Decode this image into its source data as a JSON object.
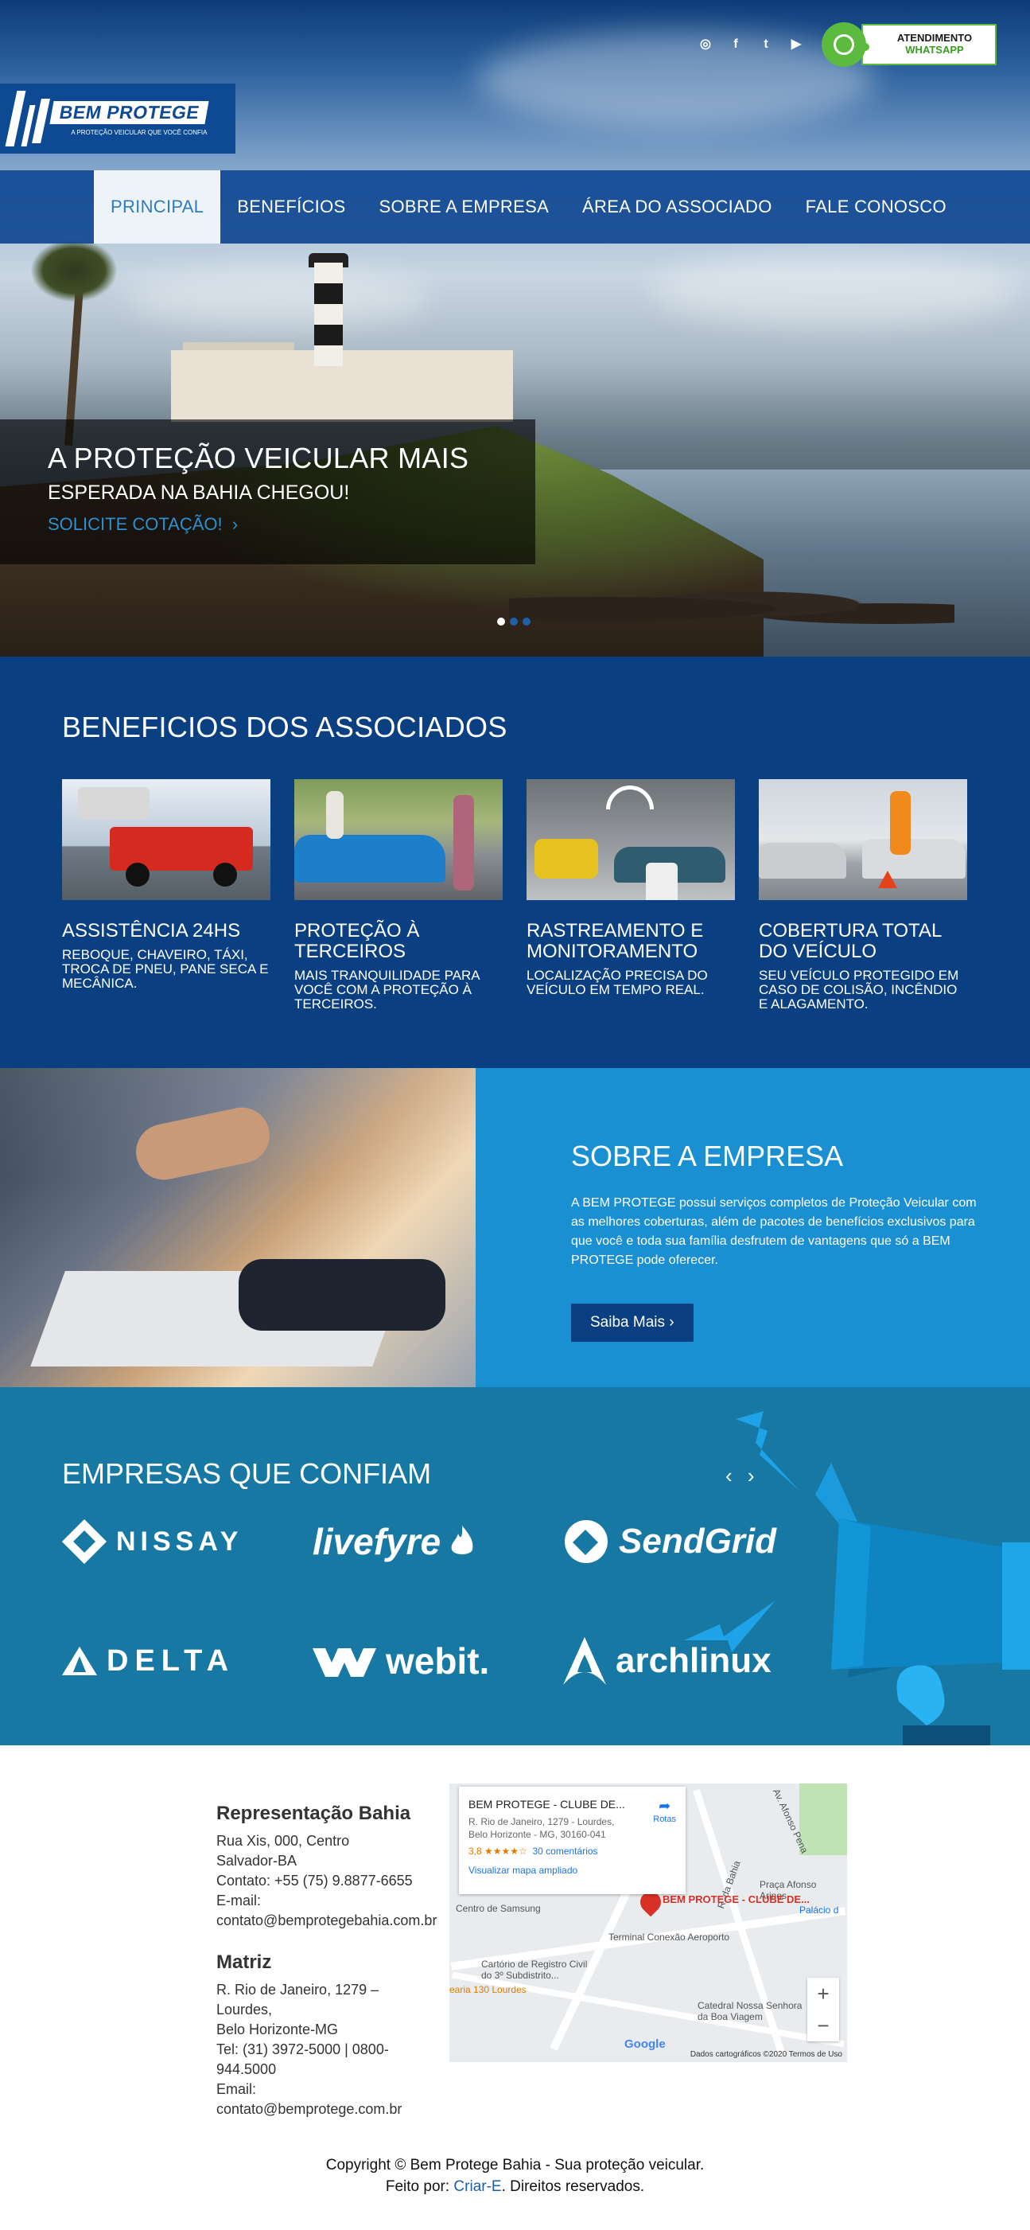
{
  "social": {
    "icons": [
      "instagram-icon",
      "facebook-icon",
      "twitter-icon",
      "youtube-icon"
    ],
    "glyphs": [
      "◎",
      "f",
      "t",
      "▶"
    ]
  },
  "whatsapp": {
    "line1": "ATENDIMENTO",
    "line2": "WHATSAPP",
    "accent": "#5cbb3f"
  },
  "logo": {
    "brand": "BEM PROTEGE",
    "tagline": "A PROTEÇÃO VEICULAR QUE VOCÊ CONFIA"
  },
  "nav": {
    "items": [
      {
        "label": "PRINCIPAL",
        "active": true
      },
      {
        "label": "BENEFÍCIOS"
      },
      {
        "label": "SOBRE A EMPRESA"
      },
      {
        "label": "ÁREA DO ASSOCIADO"
      },
      {
        "label": "FALE CONOSCO"
      }
    ]
  },
  "hero": {
    "headline": "A PROTEÇÃO VEICULAR MAIS",
    "subline": "ESPERADA NA BAHIA CHEGOU!",
    "cta": "SOLICITE COTAÇÃO!",
    "slides": 3,
    "active_slide": 1
  },
  "benefits": {
    "title": "BENEFICIOS DOS ASSOCIADOS",
    "items": [
      {
        "title": "ASSISTÊNCIA 24HS",
        "text": "REBOQUE, CHAVEIRO, TÁXI, TROCA DE PNEU, PANE SECA E MECÂNICA."
      },
      {
        "title": "PROTEÇÃO À TERCEIROS",
        "text": "MAIS TRANQUILIDADE PARA VOCÊ COM A PROTEÇÃO À TERCEIROS."
      },
      {
        "title": "RASTREAMENTO E MONITORAMENTO",
        "text": "LOCALIZAÇÃO PRECISA DO VEÍCULO EM TEMPO REAL."
      },
      {
        "title": "COBERTURA TOTAL DO VEÍCULO",
        "text": "SEU VEÍCULO PROTEGIDO EM CASO DE COLISÃO, INCÊNDIO E ALAGAMENTO."
      }
    ]
  },
  "about": {
    "title": "SOBRE A EMPRESA",
    "body": "A BEM PROTEGE possui serviços completos de Proteção Veicular com as melhores coberturas, além de pacotes de benefícios exclusivos para que você e toda sua família desfrutem de vantagens que só a BEM PROTEGE pode oferecer.",
    "button": "Saiba Mais ›"
  },
  "clients": {
    "title": "EMPRESAS QUE CONFIAM",
    "arrows": "‹ ›",
    "logos": [
      "NISSAY",
      "livefyre",
      "SendGrid",
      "DELTA",
      "webit.",
      "archlinux"
    ]
  },
  "footer": {
    "bahia": {
      "title": "Representação Bahia",
      "lines": [
        "Rua Xis, 000, Centro",
        "Salvador-BA",
        "Contato: +55 (75) 9.8877-6655",
        "E-mail:",
        "contato@bemprotegebahia.com.br"
      ]
    },
    "matriz": {
      "title": "Matriz",
      "lines": [
        "R. Rio de Janeiro, 1279 –",
        "Lourdes,",
        "Belo Horizonte-MG",
        "Tel: (31) 3972-5000 | 0800-",
        "944.5000",
        "Email:",
        "contato@bemprotege.com.br"
      ]
    },
    "map": {
      "card_title": "BEM PROTEGE - CLUBE DE...",
      "card_addr1": "R. Rio de Janeiro, 1279 - Lourdes,",
      "card_addr2": "Belo Horizonte - MG, 30160-041",
      "rating": "3,8 ★★★★☆",
      "reviews": "30 comentários",
      "link": "Visualizar mapa ampliado",
      "directions": "Rotas",
      "pin_label": "BEM PROTEGE - CLUBE DE...",
      "labels": [
        "Centro de Samsung",
        "Terminal Conexão Aeroporto",
        "Cartório de Registro Civil do 3º Subdistrito...",
        "earia 130 Lourdes",
        "Catedral Nossa Senhora da Boa Viagem",
        "Praça Afonso Arinos",
        "Palácio d",
        "Av. Afonso Pena",
        "R. da Bahia"
      ],
      "attribution": "Dados cartográficos ©2020    Termos de Uso",
      "google": "Google"
    },
    "copyright": "Copyright © Bem Protege Bahia - Sua proteção veicular.",
    "made_by_prefix": "Feito por: ",
    "made_by_link": "Criar-E",
    "made_by_suffix": ". Direitos reservados."
  }
}
